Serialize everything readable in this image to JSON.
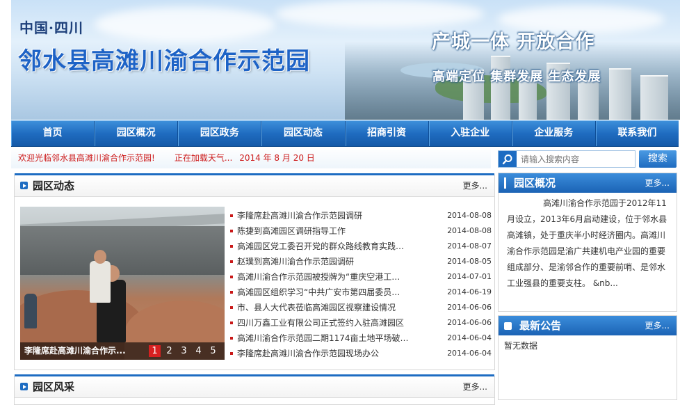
{
  "banner": {
    "region": "中国·四川",
    "site_title": "邻水县高滩川渝合作示范园",
    "slogan_main": "产城一体  开放合作",
    "slogan_sub": "高端定位  集群发展  生态发展"
  },
  "nav": {
    "items": [
      "首页",
      "园区概况",
      "园区政务",
      "园区动态",
      "招商引资",
      "入驻企业",
      "企业服务",
      "联系我们"
    ]
  },
  "ticker": {
    "welcome": "欢迎光临邻水县高滩川渝合作示范园!",
    "weather": "正在加载天气...",
    "date": "2014 年 8 月 20 日"
  },
  "search": {
    "placeholder": "请输入搜索内容",
    "button": "搜索"
  },
  "news_panel": {
    "title": "园区动态",
    "more": "更多...",
    "photo_caption": "李隆席赴高滩川渝合作示...",
    "pager": [
      "1",
      "2",
      "3",
      "4",
      "5"
    ],
    "items": [
      {
        "title": "李隆席赴高滩川渝合作示范园调研",
        "date": "2014-08-08"
      },
      {
        "title": "陈捷到高滩园区调研指导工作",
        "date": "2014-08-08"
      },
      {
        "title": "高滩园区党工委召开党的群众路线教育实践…",
        "date": "2014-08-07"
      },
      {
        "title": "赵璞到高滩川渝合作示范园调研",
        "date": "2014-08-05"
      },
      {
        "title": "高滩川渝合作示范园被授牌为“重庆空港工…",
        "date": "2014-07-01"
      },
      {
        "title": "高滩园区组织学习“中共广安市第四届委员…",
        "date": "2014-06-19"
      },
      {
        "title": "市、县人大代表莅临高滩园区视察建设情况",
        "date": "2014-06-06"
      },
      {
        "title": "四川万鑫工业有限公司正式签约入驻高滩园区",
        "date": "2014-06-06"
      },
      {
        "title": "高滩川渝合作示范园二期1174亩土地平场破…",
        "date": "2014-06-04"
      },
      {
        "title": "李隆席赴高滩川渝合作示范园现场办公",
        "date": "2014-06-04"
      }
    ]
  },
  "style_panel": {
    "title": "园区风采",
    "more": "更多..."
  },
  "overview_panel": {
    "title": "园区概况",
    "more": "更多...",
    "text": "高滩川渝合作示范园于2012年11月设立，2013年6月启动建设，位于邻水县高滩镇，处于重庆半小时经济圈内。高滩川渝合作示范园是渝广共建机电产业园的重要组成部分、是渝邻合作的重要前哨、是邻水工业强县的重要支柱。   &nb..."
  },
  "notice_panel": {
    "title": "最新公告",
    "more": "更多...",
    "empty": "暂无数据"
  },
  "colors": {
    "nav_blue": "#1f6cc0",
    "accent_red": "#cc1a1a"
  }
}
